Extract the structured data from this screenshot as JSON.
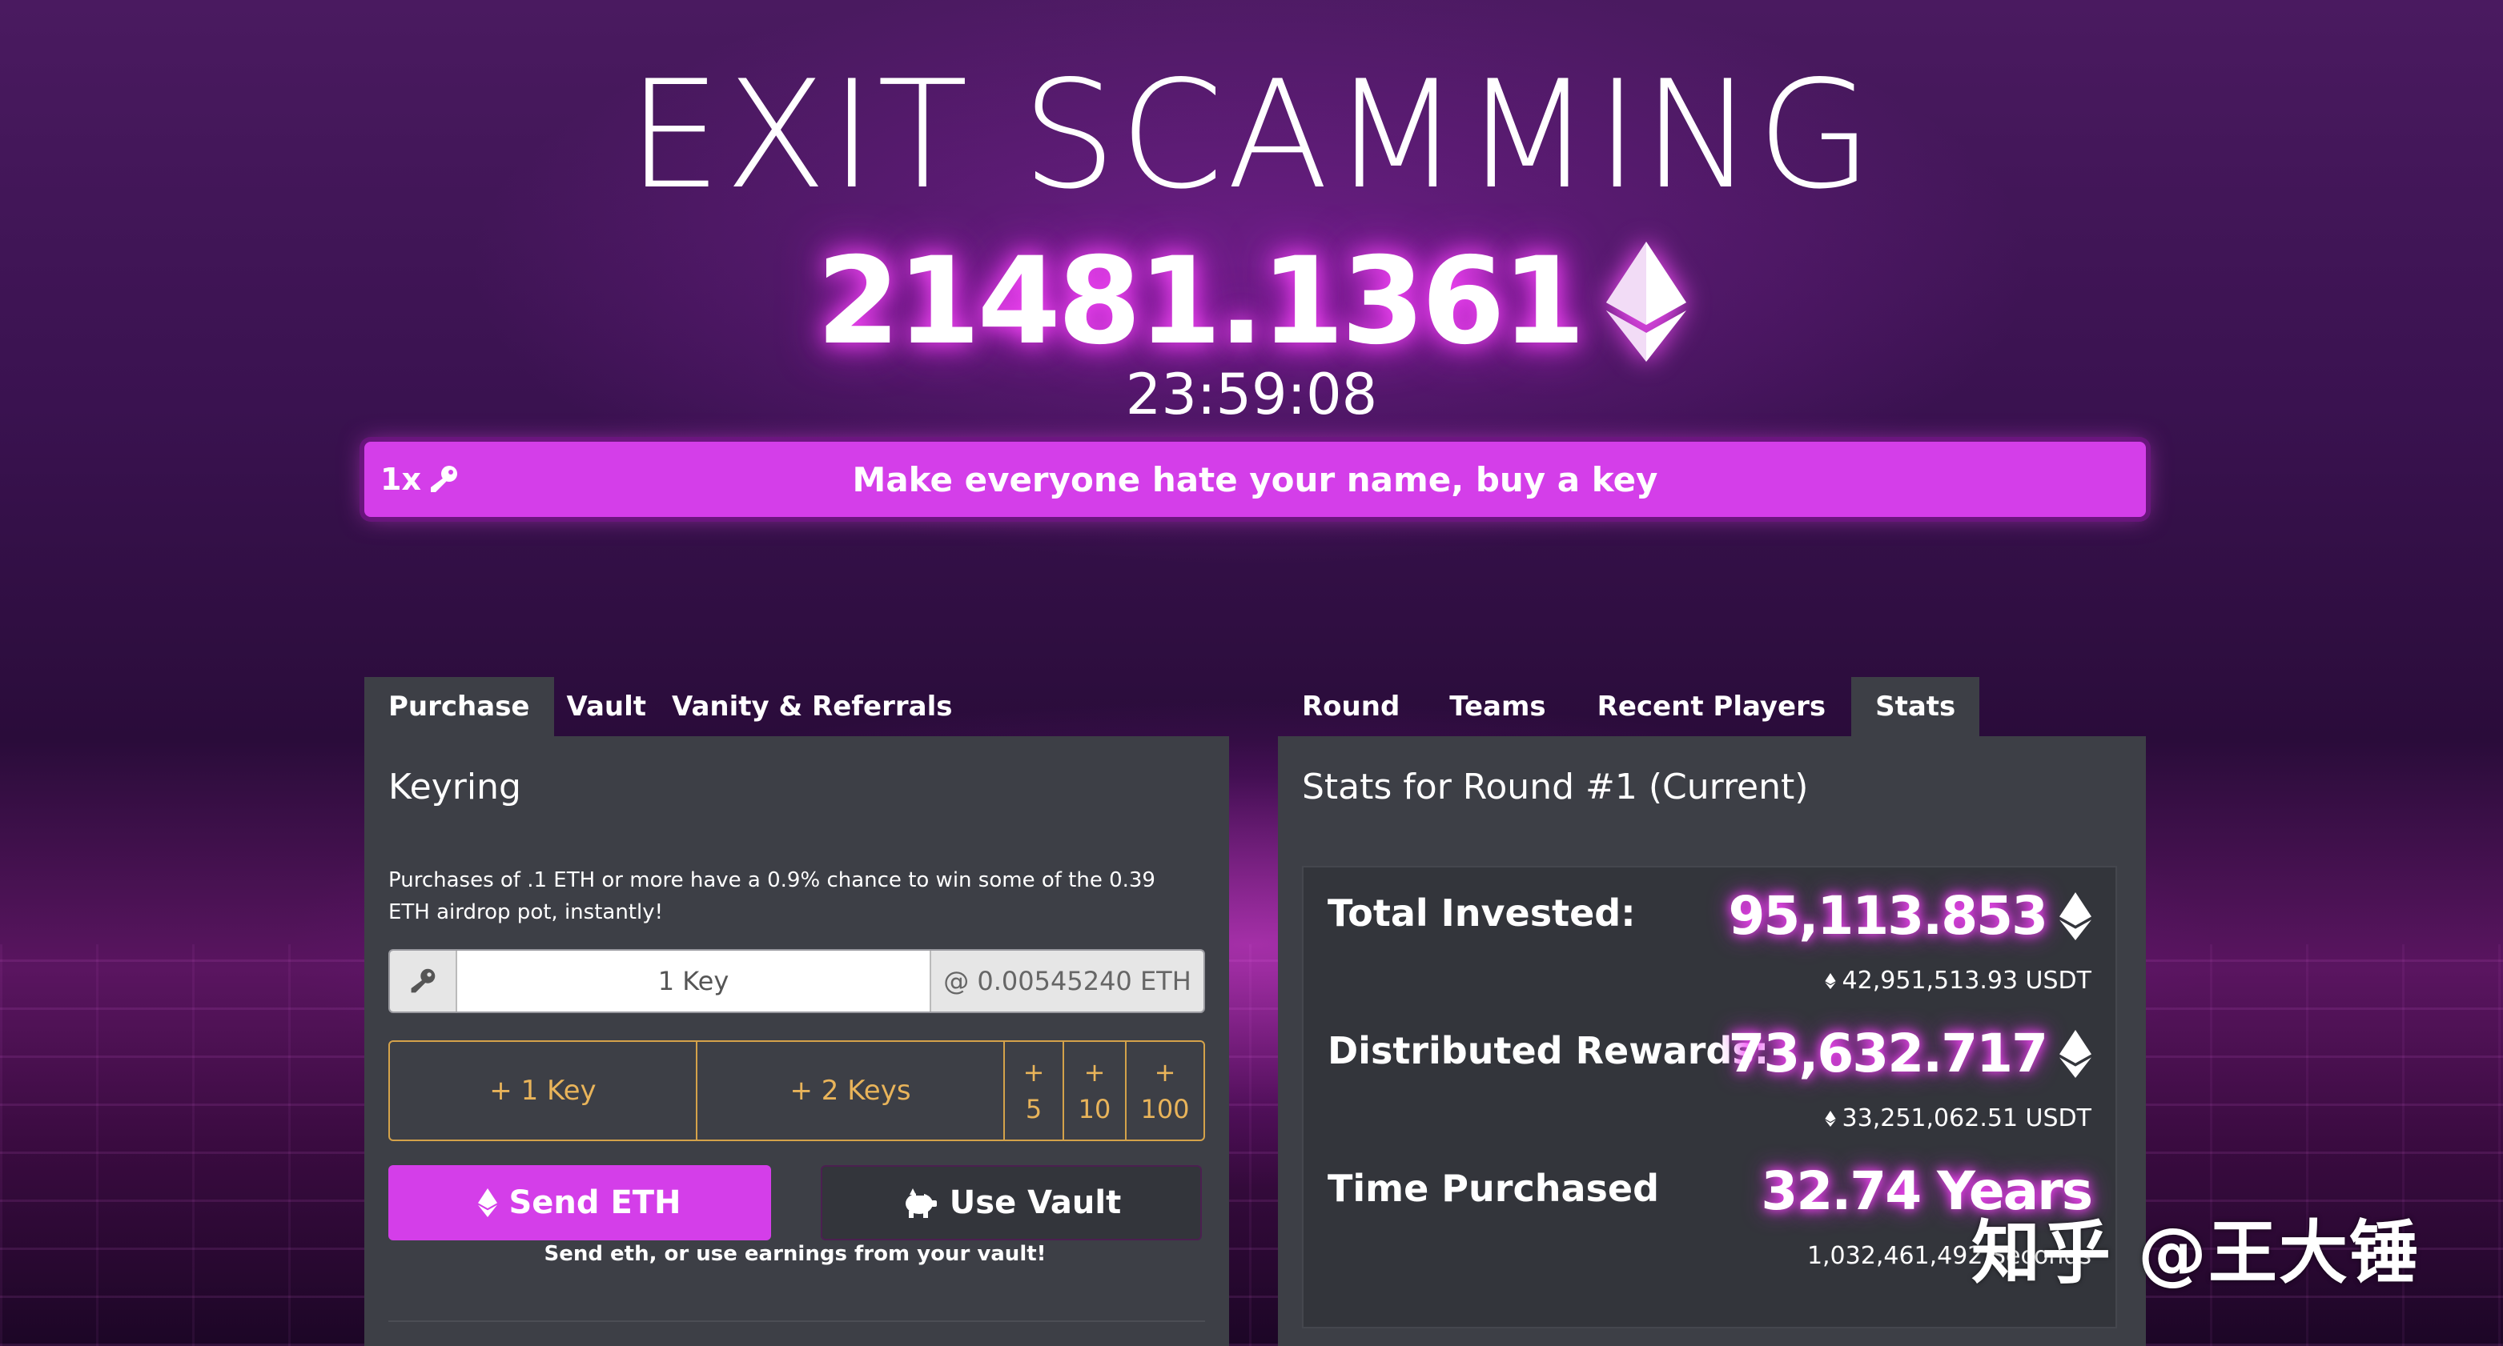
{
  "header": {
    "title": "EXIT SCAMMING",
    "pot_value": "21481.1361",
    "timer": "23:59:08"
  },
  "banner": {
    "multiplier": "1x",
    "message": "Make everyone hate your name, buy a key",
    "color": "#d43ee9"
  },
  "left_tabs": [
    {
      "label": "Purchase",
      "active": true
    },
    {
      "label": "Vault",
      "active": false
    },
    {
      "label": "Vanity & Referrals",
      "active": false
    }
  ],
  "purchase": {
    "heading": "Keyring",
    "airdrop_note": "Purchases of .1 ETH or more have a 0.9% chance to win some of the 0.39 ETH airdrop pot, instantly!",
    "key_input_value": "1 Key",
    "price": "@ 0.00545240 ETH",
    "add_buttons": [
      "+ 1 Key",
      "+ 2 Keys"
    ],
    "quick_add": [
      {
        "plus": "+",
        "amount": "5"
      },
      {
        "plus": "+",
        "amount": "10"
      },
      {
        "plus": "+",
        "amount": "100"
      }
    ],
    "send_label": "Send ETH",
    "vault_label": "Use Vault",
    "send_note": "Send eth, or use earnings from your vault!"
  },
  "right_tabs": [
    {
      "label": "Round",
      "active": false
    },
    {
      "label": "Teams",
      "active": false
    },
    {
      "label": "Recent Players",
      "active": false
    },
    {
      "label": "Stats",
      "active": true
    }
  ],
  "stats": {
    "heading": "Stats for Round #1 (Current)",
    "total_invested_label": "Total Invested:",
    "total_invested_value": "95,113.853",
    "total_invested_usdt": "42,951,513.93 USDT",
    "distributed_label": "Distributed Rewards:",
    "distributed_value": "73,632.717",
    "distributed_usdt": "33,251,062.51 USDT",
    "time_label": "Time Purchased",
    "time_value": "32.74 Years",
    "time_seconds": "1,032,461,492 Seconds"
  },
  "watermark": "知乎 @王大锤",
  "icons": [
    "ethereum-icon",
    "key-icon",
    "piggy-bank-icon"
  ],
  "colors": {
    "accent": "#d43ee9",
    "gold": "#d4a24a",
    "panel": "#3d3f46"
  }
}
